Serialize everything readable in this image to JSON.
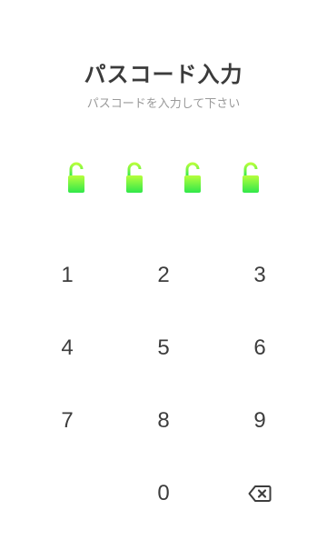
{
  "header": {
    "title": "パスコード入力",
    "subtitle": "パスコードを入力して下さい"
  },
  "passcode": {
    "length": 4,
    "entered": 0,
    "indicator_icon": "unlocked-padlock-icon",
    "indicator_color_top": "#b6ff3c",
    "indicator_color_bottom": "#2fe84a"
  },
  "keypad": {
    "keys": [
      "1",
      "2",
      "3",
      "4",
      "5",
      "6",
      "7",
      "8",
      "9",
      "",
      "0",
      "backspace"
    ],
    "backspace_icon": "backspace-icon"
  }
}
